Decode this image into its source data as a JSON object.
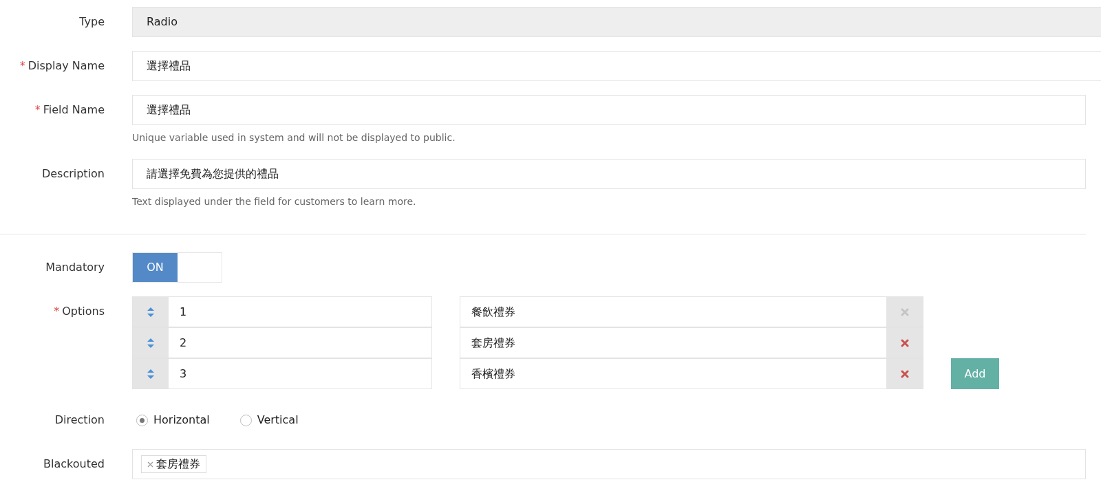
{
  "type_field": {
    "label": "Type",
    "value": "Radio"
  },
  "display_name": {
    "label": "Display Name",
    "required_mark": "*",
    "value": "選擇禮品"
  },
  "field_name": {
    "label": "Field Name",
    "required_mark": "*",
    "value": "選擇禮品",
    "help": "Unique variable used in system and will not be displayed to public."
  },
  "description": {
    "label": "Description",
    "value": "請選擇免費為您提供的禮品",
    "help": "Text displayed under the field for customers to learn more."
  },
  "mandatory": {
    "label": "Mandatory",
    "on": true,
    "on_text": "ON"
  },
  "options": {
    "label": "Options",
    "required_mark": "*",
    "add_button": "Add",
    "items": [
      {
        "value": "1",
        "text": "餐飲禮券",
        "disabled": true
      },
      {
        "value": "2",
        "text": "套房禮券",
        "disabled": false
      },
      {
        "value": "3",
        "text": "香檳禮券",
        "disabled": false
      }
    ]
  },
  "direction": {
    "label": "Direction",
    "choices": [
      {
        "label": "Horizontal",
        "selected": true
      },
      {
        "label": "Vertical",
        "selected": false
      }
    ]
  },
  "blackouted": {
    "label": "Blackouted",
    "tags": [
      "套房禮券"
    ]
  }
}
